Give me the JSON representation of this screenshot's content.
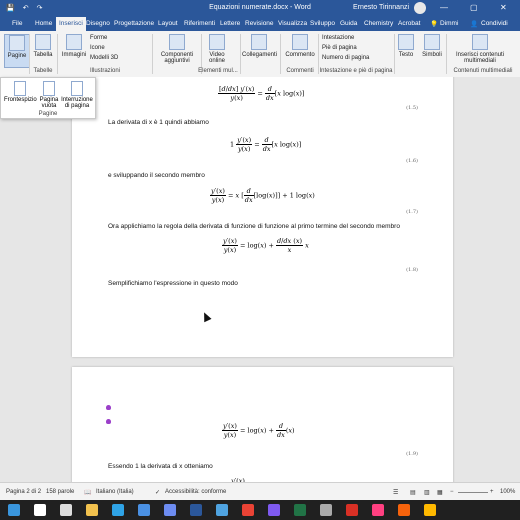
{
  "window": {
    "title": "Equazioni numerate.docx  -  Word",
    "user": "Ernesto Tirinnanzi",
    "min": "—",
    "restore": "▢",
    "close": "✕"
  },
  "quick_access": [
    "💾",
    "↶",
    "↷"
  ],
  "tabs": [
    "File",
    "Home",
    "Inserisci",
    "Disegno",
    "Progettazione",
    "Layout",
    "Riferimenti",
    "Lettere",
    "Revisione",
    "Visualizza",
    "Sviluppo",
    "Guida",
    "Chemistry",
    "Acrobat"
  ],
  "tell_me": "Dimmi",
  "share": "Condividi",
  "ribbon": {
    "pagine": "Pagine",
    "tabella": "Tabella",
    "immagini": "Immagini",
    "forme": "Forme",
    "icone": "Icone",
    "modelli3d": "Modelli 3D",
    "componenti": "Componenti aggiuntivi",
    "video": "Video online",
    "collegamenti": "Collegamenti",
    "commento": "Commento",
    "intestazione": "Intestazione",
    "pie_pagina": "Piè di pagina",
    "numero_pagina": "Numero di pagina",
    "testo": "Testo",
    "simboli": "Simboli",
    "inserisci_contenuti": "Inserisci contenuti multimediali",
    "groups": {
      "tabelle": "Tabelle",
      "illustrazioni": "Illustrazioni",
      "elementi": "Elementi mul...",
      "commenti": "Commenti",
      "intestazione_piede": "Intestazione e piè di pagina",
      "contenuti": "Contenuti multimediali"
    }
  },
  "pages_dropdown": {
    "items": [
      "Frontespizio",
      "Pagina vuota",
      "Interruzione di pagina"
    ],
    "label": "Pagine"
  },
  "document": {
    "eq5": {
      "num": "(1.5)"
    },
    "p1": "La derivata di x è 1 quindi abbiamo",
    "eq6": {
      "num": "(1.6)"
    },
    "p2": "e sviluppando il secondo membro",
    "eq7": {
      "num": "(1.7)"
    },
    "p3": "Ora applichiamo la regola della derivata di funzione di funzione al primo termine del secondo membro",
    "eq8": {
      "num": "(1.8)"
    },
    "p4": "Semplifichiamo l'espressione in questo modo",
    "eq9": {
      "num": "(1.9)"
    },
    "p5": "Essendo 1 la derivata di x otteniamo"
  },
  "status": {
    "page": "Pagina 2 di 2",
    "words": "158 parole",
    "language": "Italiano (Italia)",
    "accessibility": "Accessibilità: conforme",
    "zoom": "100%"
  },
  "taskbar": {
    "icons": [
      "windows-start",
      "search",
      "task-view",
      "file-explorer",
      "edge",
      "mail",
      "calendar",
      "word",
      "photos",
      "chrome",
      "store",
      "excel",
      "settings",
      "acrobat",
      "camera",
      "paint",
      "notes"
    ],
    "colors": [
      "#3a96dd",
      "#ffffff",
      "#dddddd",
      "#f2c14e",
      "#2fa3e6",
      "#4a90e2",
      "#6d8cf0",
      "#2b579a",
      "#4fa3e0",
      "#ea4335",
      "#7f5af0",
      "#217346",
      "#aaaaaa",
      "#d93025",
      "#ff4081",
      "#f7630c",
      "#ffb900"
    ]
  }
}
